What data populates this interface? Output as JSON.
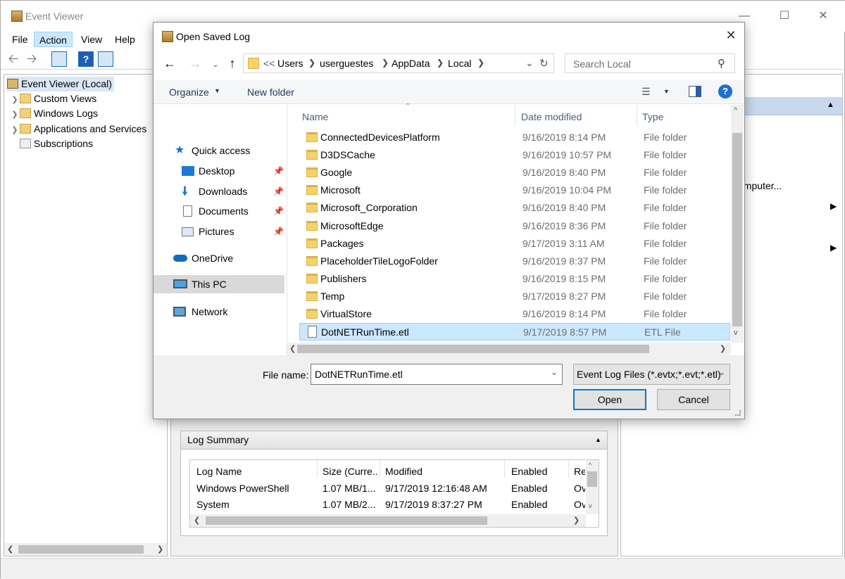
{
  "window": {
    "title": "Event Viewer",
    "menu": [
      "File",
      "Action",
      "View",
      "Help"
    ],
    "active_menu": "Action",
    "accent_color": "#0078d7"
  },
  "tree": {
    "root": "Event Viewer (Local)",
    "items": [
      "Custom Views",
      "Windows Logs",
      "Applications and Services",
      "Subscriptions"
    ]
  },
  "right_pane": {
    "partial_action": "omputer..."
  },
  "log_summary": {
    "title": "Log Summary",
    "columns": [
      "Log Name",
      "Size (Curre...",
      "Modified",
      "Enabled",
      "Re"
    ],
    "rows": [
      [
        "Windows PowerShell",
        "1.07 MB/1...",
        "9/17/2019 12:16:48 AM",
        "Enabled",
        "Ov"
      ],
      [
        "System",
        "1.07 MB/2...",
        "9/17/2019 8:37:27 PM",
        "Enabled",
        "Ov"
      ]
    ]
  },
  "dialog": {
    "title": "Open Saved Log",
    "breadcrumb_prefix": "<<",
    "breadcrumb": [
      "Users",
      "userguestes",
      "AppData",
      "Local"
    ],
    "search_placeholder": "Search Local",
    "organize_label": "Organize",
    "new_folder_label": "New folder",
    "nav": {
      "quick_access": "Quick access",
      "pinned": [
        "Desktop",
        "Downloads",
        "Documents",
        "Pictures"
      ],
      "onedrive": "OneDrive",
      "this_pc": "This PC",
      "network": "Network"
    },
    "columns": {
      "name": "Name",
      "date": "Date modified",
      "type": "Type"
    },
    "files": [
      {
        "name": "ConnectedDevicesPlatform",
        "date": "9/16/2019 8:14 PM",
        "type": "File folder",
        "kind": "folder"
      },
      {
        "name": "D3DSCache",
        "date": "9/16/2019 10:57 PM",
        "type": "File folder",
        "kind": "folder"
      },
      {
        "name": "Google",
        "date": "9/16/2019 8:40 PM",
        "type": "File folder",
        "kind": "folder"
      },
      {
        "name": "Microsoft",
        "date": "9/16/2019 10:04 PM",
        "type": "File folder",
        "kind": "folder"
      },
      {
        "name": "Microsoft_Corporation",
        "date": "9/16/2019 8:40 PM",
        "type": "File folder",
        "kind": "folder"
      },
      {
        "name": "MicrosoftEdge",
        "date": "9/16/2019 8:36 PM",
        "type": "File folder",
        "kind": "folder"
      },
      {
        "name": "Packages",
        "date": "9/17/2019 3:11 AM",
        "type": "File folder",
        "kind": "folder"
      },
      {
        "name": "PlaceholderTileLogoFolder",
        "date": "9/16/2019 8:37 PM",
        "type": "File folder",
        "kind": "folder"
      },
      {
        "name": "Publishers",
        "date": "9/16/2019 8:15 PM",
        "type": "File folder",
        "kind": "folder"
      },
      {
        "name": "Temp",
        "date": "9/17/2019 8:27 PM",
        "type": "File folder",
        "kind": "folder"
      },
      {
        "name": "VirtualStore",
        "date": "9/16/2019 8:14 PM",
        "type": "File folder",
        "kind": "folder"
      },
      {
        "name": "DotNETRunTime.etl",
        "date": "9/17/2019 8:57 PM",
        "type": "ETL File",
        "kind": "file",
        "selected": true
      }
    ],
    "file_name_label": "File name:",
    "file_name_value": "DotNETRunTime.etl",
    "file_type_value": "Event Log Files (*.evtx;*.evt;*.etl)",
    "open_label": "Open",
    "cancel_label": "Cancel"
  }
}
